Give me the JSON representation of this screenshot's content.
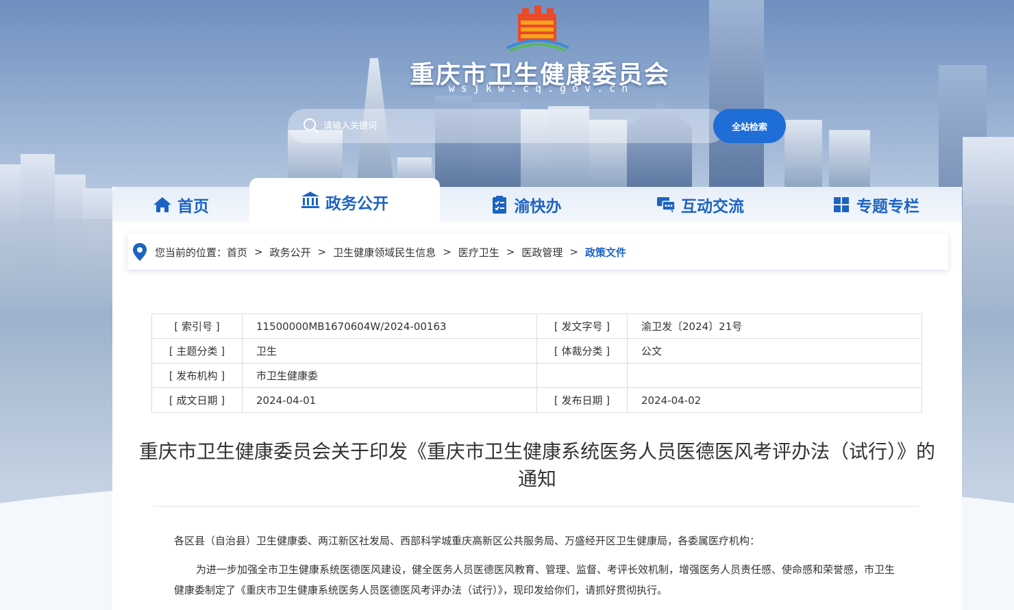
{
  "header": {
    "site_title": "重庆市卫生健康委员会",
    "site_url": "wsjkw.cq.gov.cn",
    "search_placeholder": "请输入关键词",
    "search_button": "全站检索"
  },
  "nav": {
    "items": [
      {
        "label": "首页",
        "icon": "home-icon",
        "active": false
      },
      {
        "label": "政务公开",
        "icon": "government-building-icon",
        "active": true
      },
      {
        "label": "渝快办",
        "icon": "clipboard-checklist-icon",
        "active": false
      },
      {
        "label": "互动交流",
        "icon": "chat-bubbles-icon",
        "active": false
      },
      {
        "label": "专题专栏",
        "icon": "grid-icon",
        "active": false
      }
    ]
  },
  "breadcrumb": {
    "prefix": "您当前的位置：",
    "items": [
      "首页",
      "政务公开",
      "卫生健康领域民生信息",
      "医疗卫生",
      "医政管理"
    ],
    "current": "政策文件",
    "separator": ">"
  },
  "info": {
    "rows": [
      {
        "label1": "[ 索引号 ]",
        "value1": "11500000MB1670604W/2024-00163",
        "label2": "[ 发文字号 ]",
        "value2": "渝卫发〔2024〕21号"
      },
      {
        "label1": "[ 主题分类 ]",
        "value1": "卫生",
        "label2": "[ 体裁分类 ]",
        "value2": "公文"
      },
      {
        "label1": "[ 发布机构 ]",
        "value1": "市卫生健康委",
        "label2": "",
        "value2": ""
      },
      {
        "label1": "[ 成文日期 ]",
        "value1": "2024-04-01",
        "label2": "[ 发布日期 ]",
        "value2": "2024-04-02"
      }
    ]
  },
  "document": {
    "title": "重庆市卫生健康委员会关于印发《重庆市卫生健康系统医务人员医德医风考评办法（试行）》的通知",
    "addressee": "各区县（自治县）卫生健康委、两江新区社发局、西部科学城重庆高新区公共服务局、万盛经开区卫生健康局，各委属医疗机构：",
    "body": "为进一步加强全市卫生健康系统医德医风建设，健全医务人员医德医风教育、管理、监督、考评长效机制，增强医务人员责任感、使命感和荣誉感，市卫生健康委制定了《重庆市卫生健康系统医务人员医德医风考评办法（试行）》，现印发给你们，请抓好贯彻执行。"
  },
  "colors": {
    "primary": "#1d63c2",
    "search_button": "#1f6dd6",
    "text": "#333333"
  }
}
